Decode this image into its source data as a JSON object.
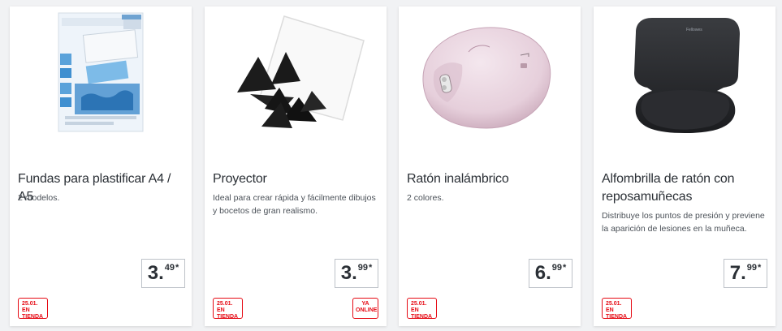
{
  "products": [
    {
      "image_name": "laminating-pouches-image",
      "title": "Fundas para plastificar A4 / A5",
      "description": "2 modelos.",
      "price_int": "3.",
      "price_dec": "49",
      "price_mark": "*",
      "store_date": "25.01.",
      "store_suffix": "EN",
      "store_label": "TIENDA"
    },
    {
      "image_name": "drawing-projector-image",
      "title": "Proyector",
      "description": "Ideal para crear rápida y fácilmente dibujos y bocetos de gran realismo.",
      "price_int": "3.",
      "price_dec": "99",
      "price_mark": "*",
      "store_date": "25.01.",
      "store_suffix": "EN",
      "store_label": "TIENDA",
      "online_line1": "YA",
      "online_line2": "ONLINE"
    },
    {
      "image_name": "wireless-mouse-image",
      "title": "Ratón inalámbrico",
      "description": "2 colores.",
      "price_int": "6.",
      "price_dec": "99",
      "price_mark": "*",
      "store_date": "25.01.",
      "store_suffix": "EN",
      "store_label": "TIENDA"
    },
    {
      "image_name": "mouse-pad-image",
      "title": "Alfombrilla de ratón con reposamuñecas",
      "description": "Distribuye los puntos de presión y previene la aparición de lesiones en la muñeca.",
      "price_int": "7.",
      "price_dec": "99",
      "price_mark": "*",
      "store_date": "25.01.",
      "store_suffix": "EN",
      "store_label": "TIENDA",
      "brand_print": "Fellowes"
    }
  ],
  "colors": {
    "accent_red": "#e60a14",
    "text": "#2b3036",
    "border": "#bdc2c8"
  }
}
